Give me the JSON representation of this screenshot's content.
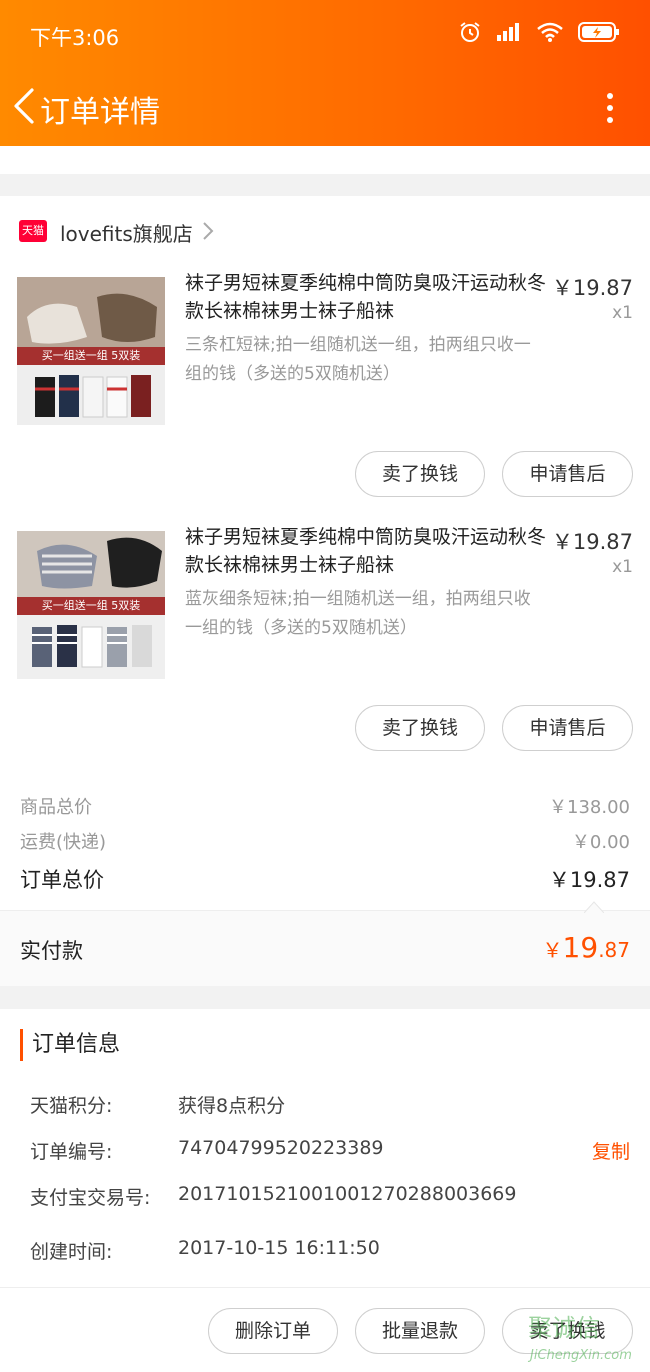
{
  "status_bar": {
    "time": "下午3:06"
  },
  "nav": {
    "title": "订单详情"
  },
  "store": {
    "badge": "天猫",
    "name": "lovefits旗舰店"
  },
  "items": [
    {
      "title": "袜子男短袜夏季纯棉中筒防臭吸汗运动秋冬款长袜棉袜男士袜子船袜",
      "spec": "三条杠短袜;拍一组随机送一组，拍两组只收一组的钱（多送的5双随机送）",
      "price": "￥19.87",
      "qty": "x1",
      "thumb_caption": "买一组送一组 5双装",
      "sell_label": "卖了换钱",
      "aftersale_label": "申请售后"
    },
    {
      "title": "袜子男短袜夏季纯棉中筒防臭吸汗运动秋冬款长袜棉袜男士袜子船袜",
      "spec": "蓝灰细条短袜;拍一组随机送一组，拍两组只收一组的钱（多送的5双随机送）",
      "price": "￥19.87",
      "qty": "x1",
      "thumb_caption": "买一组送一组 5双装",
      "sell_label": "卖了换钱",
      "aftersale_label": "申请售后"
    }
  ],
  "summary": {
    "goods_total_label": "商品总价",
    "goods_total_value": "￥138.00",
    "shipping_label": "运费(快递)",
    "shipping_value": "￥0.00",
    "order_total_label": "订单总价",
    "order_total_value": "￥19.87",
    "paid_label": "实付款",
    "paid_currency": "￥",
    "paid_int": "19",
    "paid_dec": ".87"
  },
  "order_info": {
    "title": "订单信息",
    "points_label": "天猫积分:",
    "points_value": "获得8点积分",
    "order_no_label": "订单编号:",
    "order_no_value": "74704799520223389",
    "copy_label": "复制",
    "alipay_label": "支付宝交易号:",
    "alipay_value": "2017101521001001270288003669",
    "created_label": "创建时间:",
    "created_value": "2017-10-15 16:11:50"
  },
  "footer": {
    "delete_label": "删除订单",
    "batch_refund_label": "批量退款",
    "sell_label": "卖了换钱"
  },
  "watermark": {
    "text": "聚诚信",
    "url": "JiChengXin.com"
  },
  "colors": {
    "accent": "#ff5000",
    "header_start": "#ff8a00",
    "header_end": "#ff5000",
    "tmall_red": "#ff0036"
  }
}
